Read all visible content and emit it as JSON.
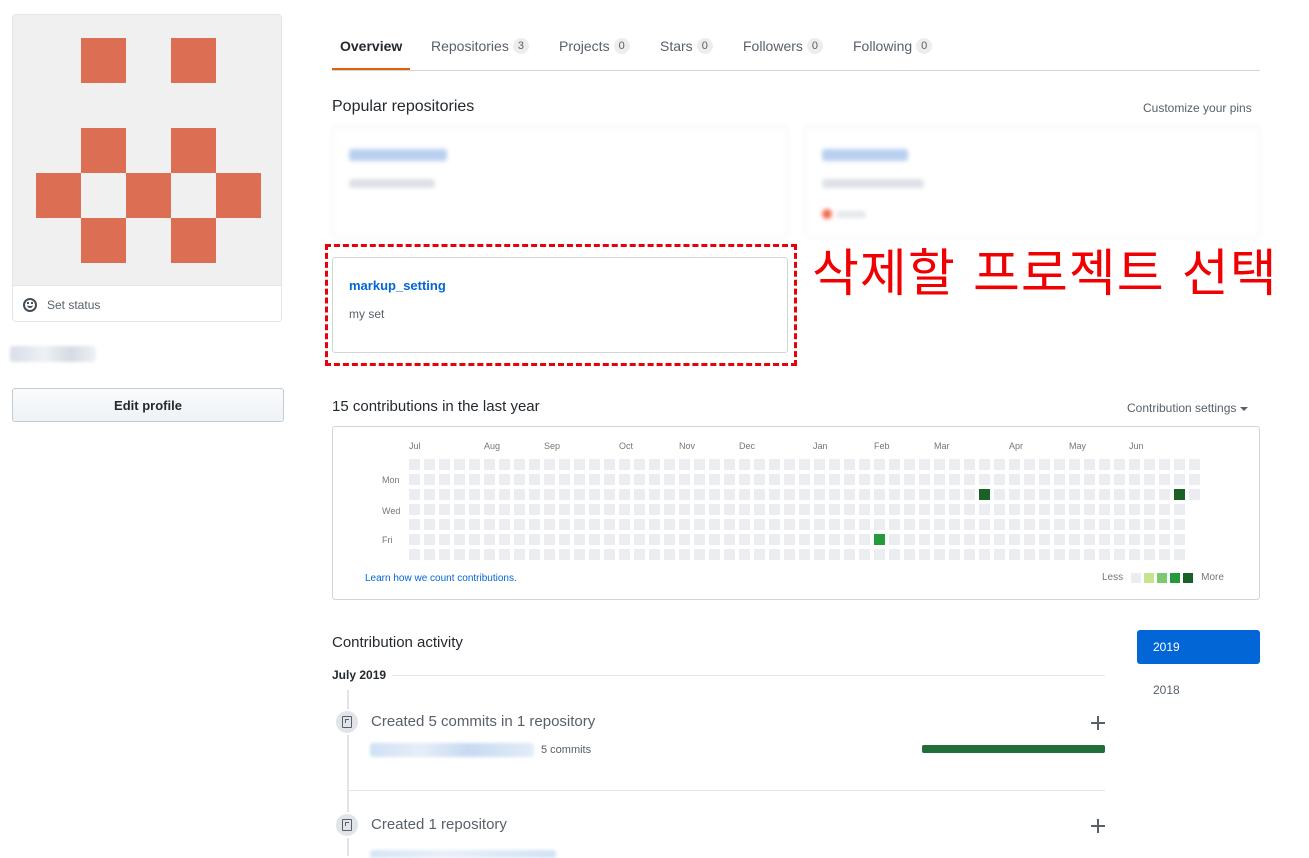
{
  "profile": {
    "set_status_label": "Set status",
    "edit_profile_label": "Edit profile",
    "avatar_color": "#dc6e53"
  },
  "tabs": [
    {
      "label": "Overview",
      "count": null,
      "selected": true
    },
    {
      "label": "Repositories",
      "count": "3",
      "selected": false
    },
    {
      "label": "Projects",
      "count": "0",
      "selected": false
    },
    {
      "label": "Stars",
      "count": "0",
      "selected": false
    },
    {
      "label": "Followers",
      "count": "0",
      "selected": false
    },
    {
      "label": "Following",
      "count": "0",
      "selected": false
    }
  ],
  "popular": {
    "title": "Popular repositories",
    "customize_label": "Customize your pins",
    "visible_repo": {
      "name": "markup_setting",
      "description": "my set"
    }
  },
  "annotation": {
    "text": "삭제할 프로젝트 선택",
    "color": "#f00000"
  },
  "contributions": {
    "title": "15 contributions in the last year",
    "settings_label": "Contribution settings",
    "months": [
      "Jul",
      "Aug",
      "Sep",
      "Oct",
      "Nov",
      "Dec",
      "Jan",
      "Feb",
      "Mar",
      "Apr",
      "May",
      "Jun"
    ],
    "days": [
      "Mon",
      "Wed",
      "Fri"
    ],
    "learn_link": "Learn how we count contributions.",
    "legend_less": "Less",
    "legend_more": "More",
    "level_colors": [
      "#ebedf0",
      "#c6e48b",
      "#7bc96f",
      "#239a3b",
      "#196127"
    ],
    "active_cells": [
      {
        "week": 38,
        "day": 2,
        "level": 4
      },
      {
        "week": 51,
        "day": 2,
        "level": 4
      },
      {
        "week": 31,
        "day": 5,
        "level": 3
      }
    ]
  },
  "activity": {
    "title": "Contribution activity",
    "years": [
      "2019",
      "2018"
    ],
    "selected_year": "2019",
    "month_heading": "July 2019",
    "items": [
      {
        "text": "Created 5 commits in 1 repository",
        "commits_label": "5 commits"
      },
      {
        "text": "Created 1 repository"
      }
    ]
  }
}
